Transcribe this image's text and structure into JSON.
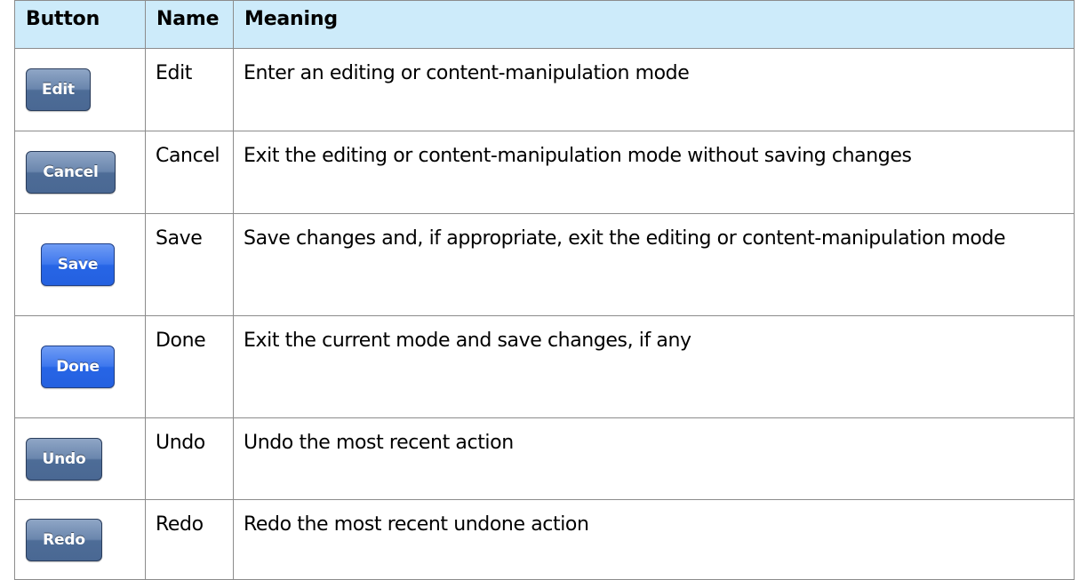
{
  "table": {
    "headers": {
      "button": "Button",
      "name": "Name",
      "meaning": "Meaning"
    },
    "rows": [
      {
        "button_label": "Edit",
        "style": "plain",
        "name": "Edit",
        "meaning": "Enter an editing or content-manipulation mode"
      },
      {
        "button_label": "Cancel",
        "style": "plain",
        "name": "Cancel",
        "meaning": "Exit the editing or content-manipulation mode without saving changes"
      },
      {
        "button_label": "Save",
        "style": "done",
        "name": "Save",
        "meaning": "Save changes and, if appropriate, exit the editing or content-manipulation mode"
      },
      {
        "button_label": "Done",
        "style": "done",
        "name": "Done",
        "meaning": "Exit the current mode and save changes, if any"
      },
      {
        "button_label": "Undo",
        "style": "plain",
        "name": "Undo",
        "meaning": "Undo the most recent action"
      },
      {
        "button_label": "Redo",
        "style": "plain",
        "name": "Redo",
        "meaning": "Redo the most recent undone action"
      }
    ]
  },
  "colors": {
    "header_background": "#cdebfa",
    "border": "#8c8c8c",
    "plain_button": "#5e7aa3",
    "done_button": "#2f6de8"
  }
}
